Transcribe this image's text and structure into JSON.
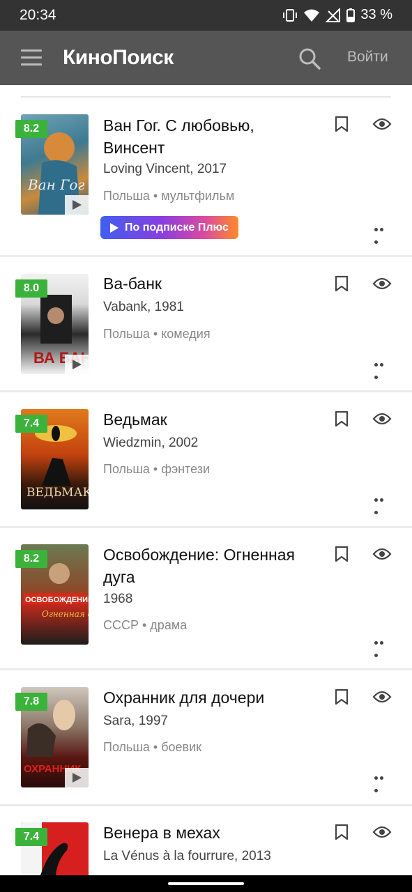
{
  "status_bar": {
    "time": "20:34",
    "battery": "33 %"
  },
  "app_bar": {
    "logo": "КиноПоиск",
    "login": "Войти"
  },
  "films": [
    {
      "rating": "8.2",
      "title": "Ван Гог. С любовью, Винсент",
      "subtitle": "Loving Vincent, 2017",
      "meta": "Польша • мультфильм",
      "badge": "По подписке Плюс",
      "rating_color": "#3bb33b"
    },
    {
      "rating": "8.0",
      "title": "Ва-банк",
      "subtitle": "Vabank, 1981",
      "meta": "Польша • комедия"
    },
    {
      "rating": "7.4",
      "title": "Ведьмак",
      "subtitle": "Wiedzmin, 2002",
      "meta": "Польша • фэнтези"
    },
    {
      "rating": "8.2",
      "title": "Освобождение: Огненная дуга",
      "subtitle": "1968",
      "meta": "СССР • драма"
    },
    {
      "rating": "7.8",
      "title": "Охранник для дочери",
      "subtitle": "Sara, 1997",
      "meta": "Польша • боевик"
    },
    {
      "rating": "7.4",
      "title": "Венера в мехах",
      "subtitle": "La Vénus à la fourrure, 2013",
      "meta": ""
    }
  ],
  "icons": [
    "vibrate-icon",
    "wifi-icon",
    "no-signal-icon",
    "battery-icon",
    "menu-icon",
    "search-icon",
    "bookmark-icon",
    "eye-icon",
    "more-icon",
    "play-icon"
  ]
}
